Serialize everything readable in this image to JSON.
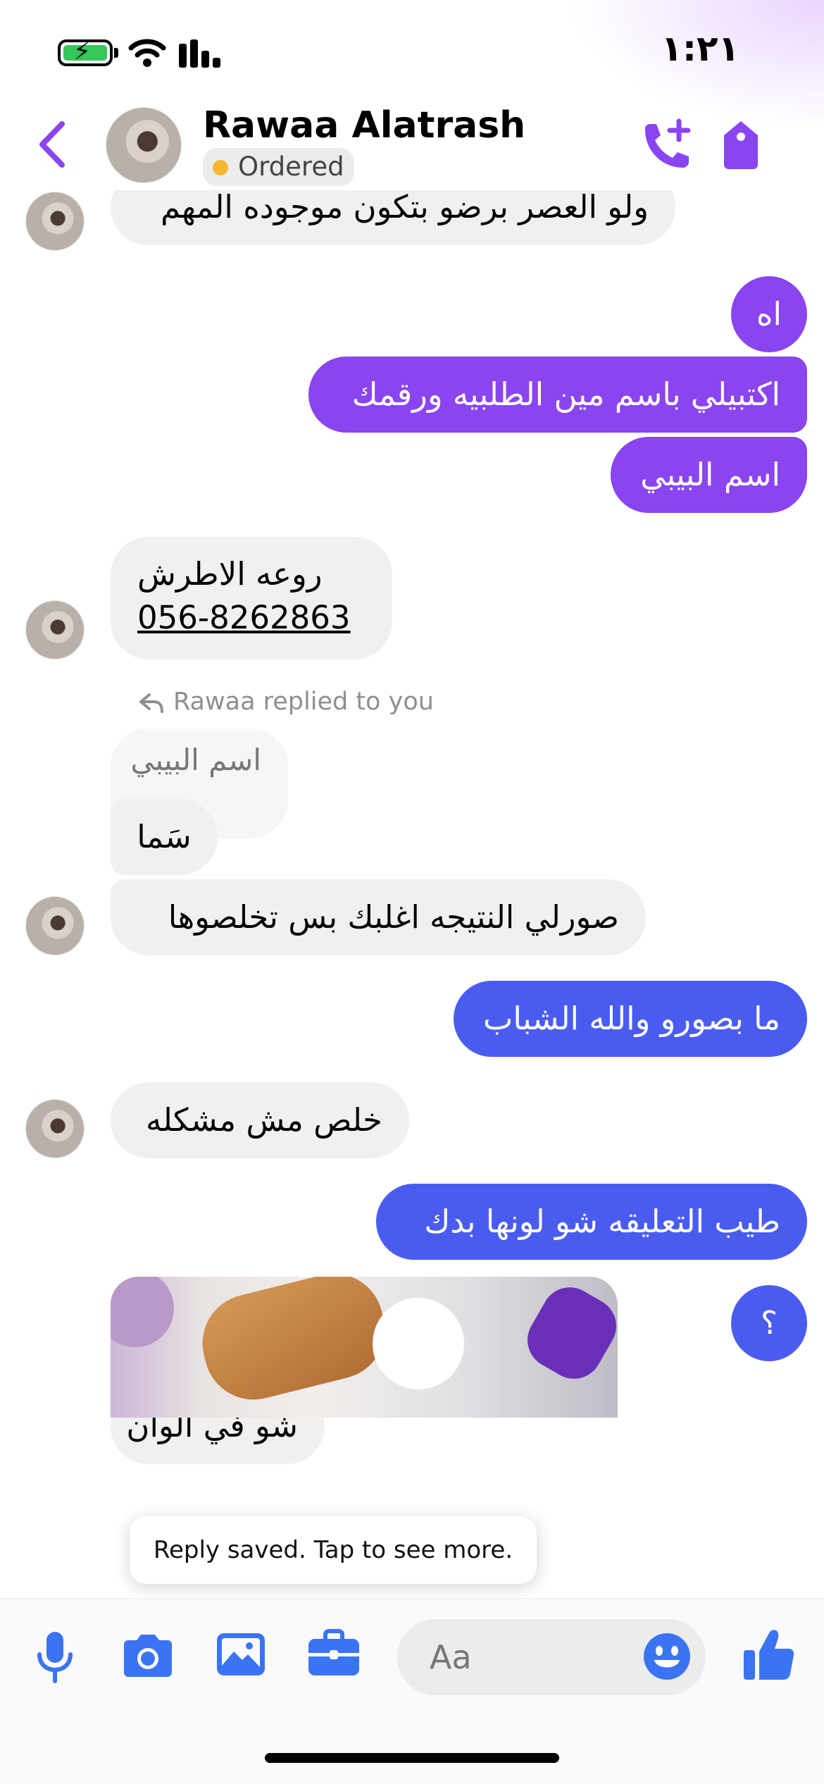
{
  "status_bar": {
    "time": "١:٢١",
    "icons": [
      "battery-charging-icon",
      "wifi-icon",
      "signal-icon"
    ]
  },
  "header": {
    "contact_name": "Rawaa Alatrash",
    "label": "Ordered",
    "label_color": "#f6b831",
    "icons": [
      "back-chevron-icon",
      "add-call-icon",
      "tag-icon"
    ],
    "accent_color": "#8a44f0"
  },
  "messages": {
    "m1": "ولو العصر برضو بتكون موجوده المهم",
    "m2": "اه",
    "m3": "اكتبيلي باسم مين الطلبيه ورقمك",
    "m4": "اسم البيبي",
    "m5_line1": "روعه الاطرش",
    "m5_line2": "056-8262863",
    "reply_note": "Rawaa replied to you",
    "quoted": "اسم البيبي",
    "m6": "سَما",
    "m7": "صورلي النتيجه اغلبك بس تخلصوها",
    "m8": "ما بصورو والله الشباب",
    "m9": "خلص مش مشكله",
    "m10": "طيب التعليقه شو لونها بدك",
    "m11": "؟",
    "m12": "شو في الوان"
  },
  "colors": {
    "incoming": "#f0f0f0",
    "outgoing_purple": "#8a44f0",
    "outgoing_blue": "#4a5cf0",
    "composer_accent": "#3b74f2"
  },
  "toast": {
    "text": "Reply saved. Tap to see more."
  },
  "composer": {
    "placeholder": "Aa",
    "icons": [
      "microphone-icon",
      "camera-icon",
      "photo-gallery-icon",
      "briefcase-icon",
      "emoji-icon",
      "thumbs-up-icon"
    ]
  }
}
